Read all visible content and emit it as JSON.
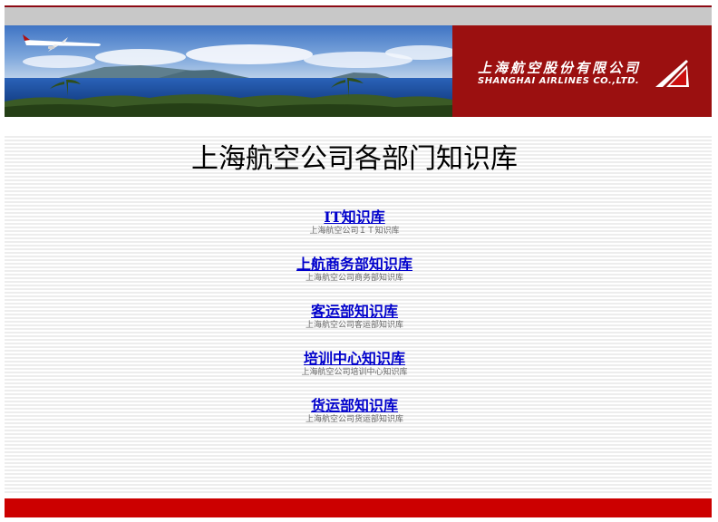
{
  "header": {
    "brand_cn": "上海航空股份有限公司",
    "brand_en": "SHANGHAI AIRLINES CO.,LTD.",
    "brand_color": "#9b1010"
  },
  "main": {
    "title": "上海航空公司各部门知识库",
    "items": [
      {
        "label": "IT知识库",
        "desc": "上海航空公司ＩＴ知识库"
      },
      {
        "label": "上航商务部知识库",
        "desc": "上海航空公司商务部知识库"
      },
      {
        "label": "客运部知识库",
        "desc": "上海航空公司客运部知识库"
      },
      {
        "label": "培训中心知识库",
        "desc": "上海航空公司培训中心知识库"
      },
      {
        "label": "货运部知识库",
        "desc": "上海航空公司货运部知识库"
      }
    ]
  },
  "colors": {
    "link": "#0000cc",
    "footer_bar": "#cc0000",
    "top_bar": "#c8c8c8"
  }
}
